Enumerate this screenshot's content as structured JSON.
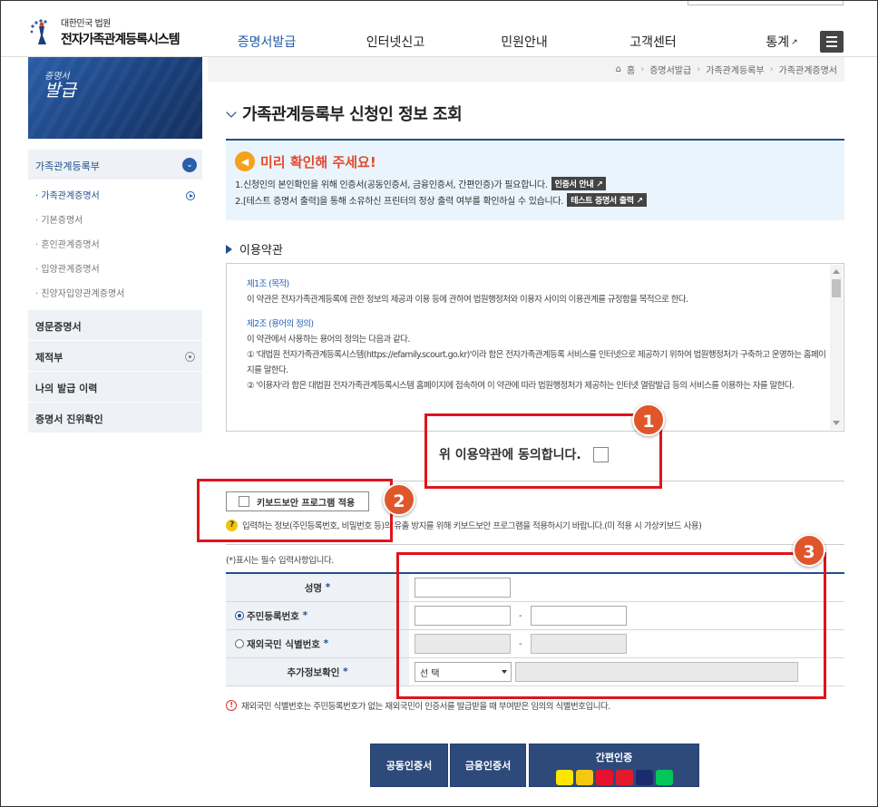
{
  "header": {
    "logo_sub": "대한민국 법원",
    "logo_main": "전자가족관계등록시스템",
    "nav": [
      "증명서발급",
      "인터넷신고",
      "민원안내",
      "고객센터",
      "통계"
    ],
    "menu_icon": "hamburger-icon"
  },
  "sidebar": {
    "visual_small": "증명서",
    "visual_big": "발급",
    "groups": [
      {
        "label": "가족관계등록부",
        "expanded": true
      },
      {
        "label": "영문증명서"
      },
      {
        "label": "제적부"
      },
      {
        "label": "나의 발급 이력"
      },
      {
        "label": "증명서 진위확인"
      }
    ],
    "sub_items": [
      "가족관계증명서",
      "기본증명서",
      "혼인관계증명서",
      "입양관계증명서",
      "친양자입양관계증명서"
    ]
  },
  "breadcrumb": [
    "홈",
    "증명서발급",
    "가족관계등록부",
    "가족관계증명서"
  ],
  "page_title": "가족관계등록부 신청인 정보 조회",
  "notice": {
    "title": "미리 확인해 주세요!",
    "line1": "1.신청인의 본인확인을 위해 인증서(공동인증서, 금융인증서, 간편인증)가 필요합니다.",
    "line1_tag": "인증서 안내",
    "line2": "2.[테스트 증명서 출력]을 통해 소유하신 프린터의 정상 출력 여부를 확인하실 수 있습니다.",
    "line2_tag": "테스트 증명서 출력"
  },
  "terms": {
    "section_title": "이용약관",
    "a1_title": "제1조 (목적)",
    "a1_body": "이 약관은 전자가족관계등록에 관한 정보의 제공과 이용 등에 관하여 법원행정처와 이용자 사이의 이용관계를 규정함을 목적으로 한다.",
    "a2_title": "제2조 (용어의 정의)",
    "a2_body": "이 약관에서 사용하는 용어의 정의는 다음과 같다.",
    "a2_item1": "① '대법원 전자가족관계등록시스템(https://efamily.scourt.go.kr)'이라 함은 전자가족관계등록 서비스를 인터넷으로 제공하기 위하여 법원행정처가 구축하고 운영하는 홈페이지를 말한다.",
    "a2_item2": "② '이용자'라 함은 대법원 전자가족관계등록시스템 홈페이지에 접속하여 이 약관에 따라 법원행정처가 제공하는 인터넷 열람발급 등의 서비스를 이용하는 자를 말한다.",
    "agree_label": "위 이용약관에 동의합니다."
  },
  "keyboard": {
    "button_label": "키보드보안 프로그램 적용",
    "note": "입력하는 정보(주민등록번호, 비밀번호 등)의 유출 방지를 위해 키보드보안 프로그램을 적용하시기 바랍니다.(미 적용 시 가상키보드 사용)"
  },
  "form": {
    "required_note": "(*)표시는 필수 입력사항입니다.",
    "name_label": "성명",
    "rrn_label": "주민등록번호",
    "foreign_label": "재외국민 식별번호",
    "extra_label": "추가정보확인",
    "select_value": "선 택",
    "required_mark": "*"
  },
  "warning": "재외국민 식별번호는 주민등록번호가 없는 재외국민이 인증서를 발급받을 때 부여받은 임의의 식별번호입니다.",
  "buttons": {
    "joint_cert": "공동인증서",
    "finance_cert": "금융인증서",
    "simple_cert": "간편인증"
  },
  "annotations": [
    "1",
    "2",
    "3"
  ],
  "colors": {
    "accent": "#1f4f8f",
    "annotation_red": "#e0141a",
    "badge": "#e0562b"
  }
}
